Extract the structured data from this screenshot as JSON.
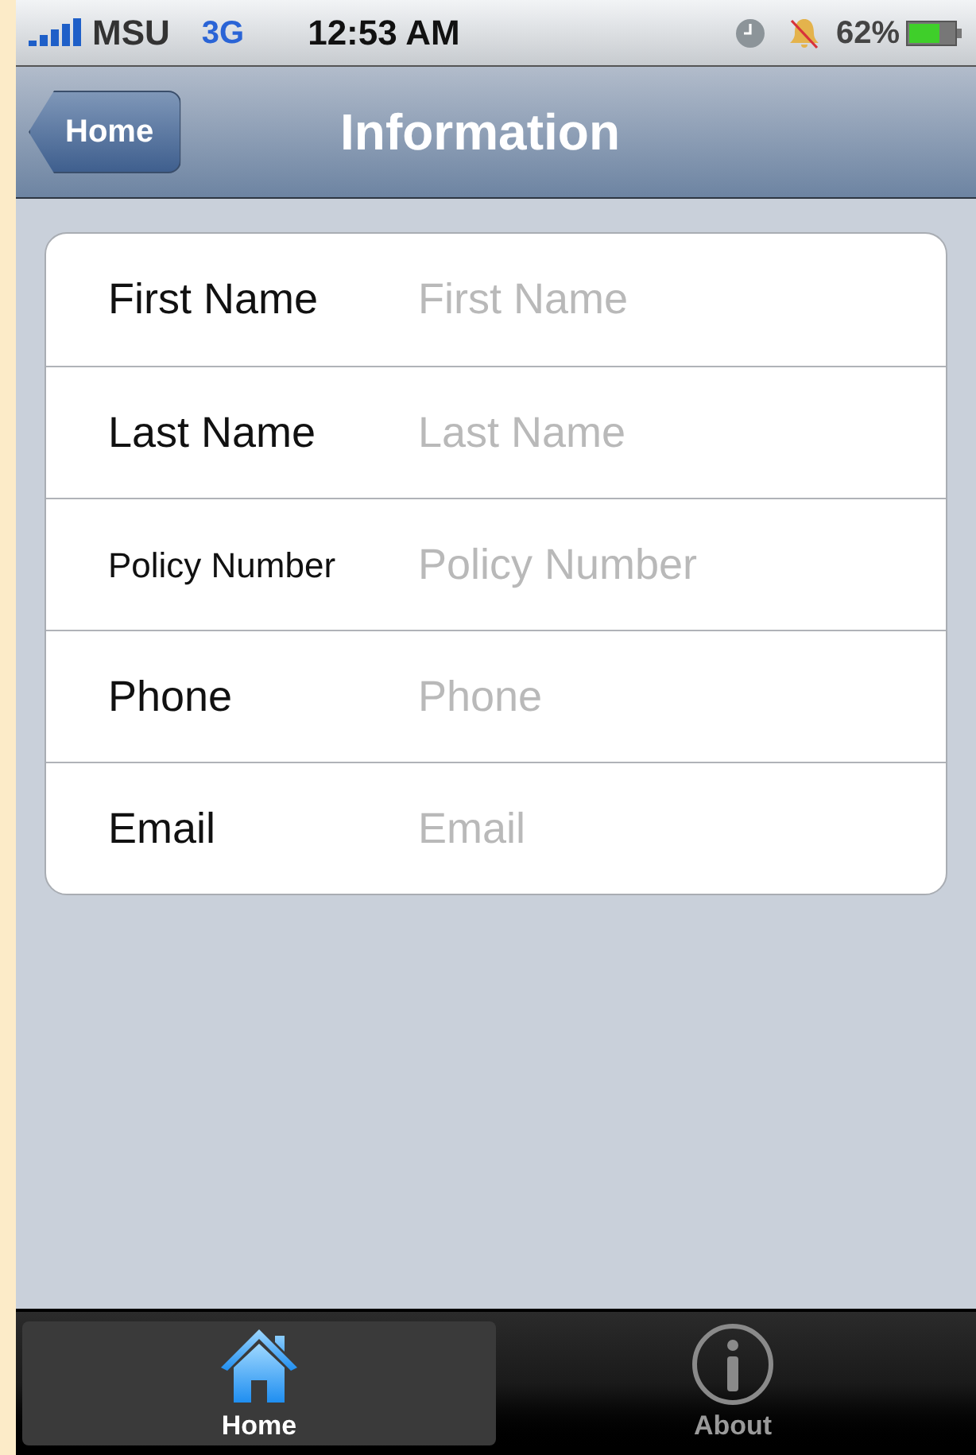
{
  "status_bar": {
    "carrier": "MSU",
    "network": "3G",
    "time": "12:53 AM",
    "battery": "62%"
  },
  "nav_bar": {
    "back_button": "Home",
    "title": "Information"
  },
  "form": {
    "rows": [
      {
        "label": "First Name",
        "placeholder": "First Name",
        "kind": "normal"
      },
      {
        "label": "Last Name",
        "placeholder": "Last Name",
        "kind": "normal"
      },
      {
        "label": "Policy Number",
        "placeholder": "Policy Number",
        "kind": "small"
      },
      {
        "label": "Phone",
        "placeholder": "Phone",
        "kind": "normal"
      },
      {
        "label": "Email",
        "placeholder": "Email",
        "kind": "normal"
      }
    ]
  },
  "tab_bar": {
    "tabs": [
      {
        "label": "Home",
        "kind": "home",
        "selected": true
      },
      {
        "label": "About",
        "kind": "info",
        "selected": false
      }
    ]
  }
}
